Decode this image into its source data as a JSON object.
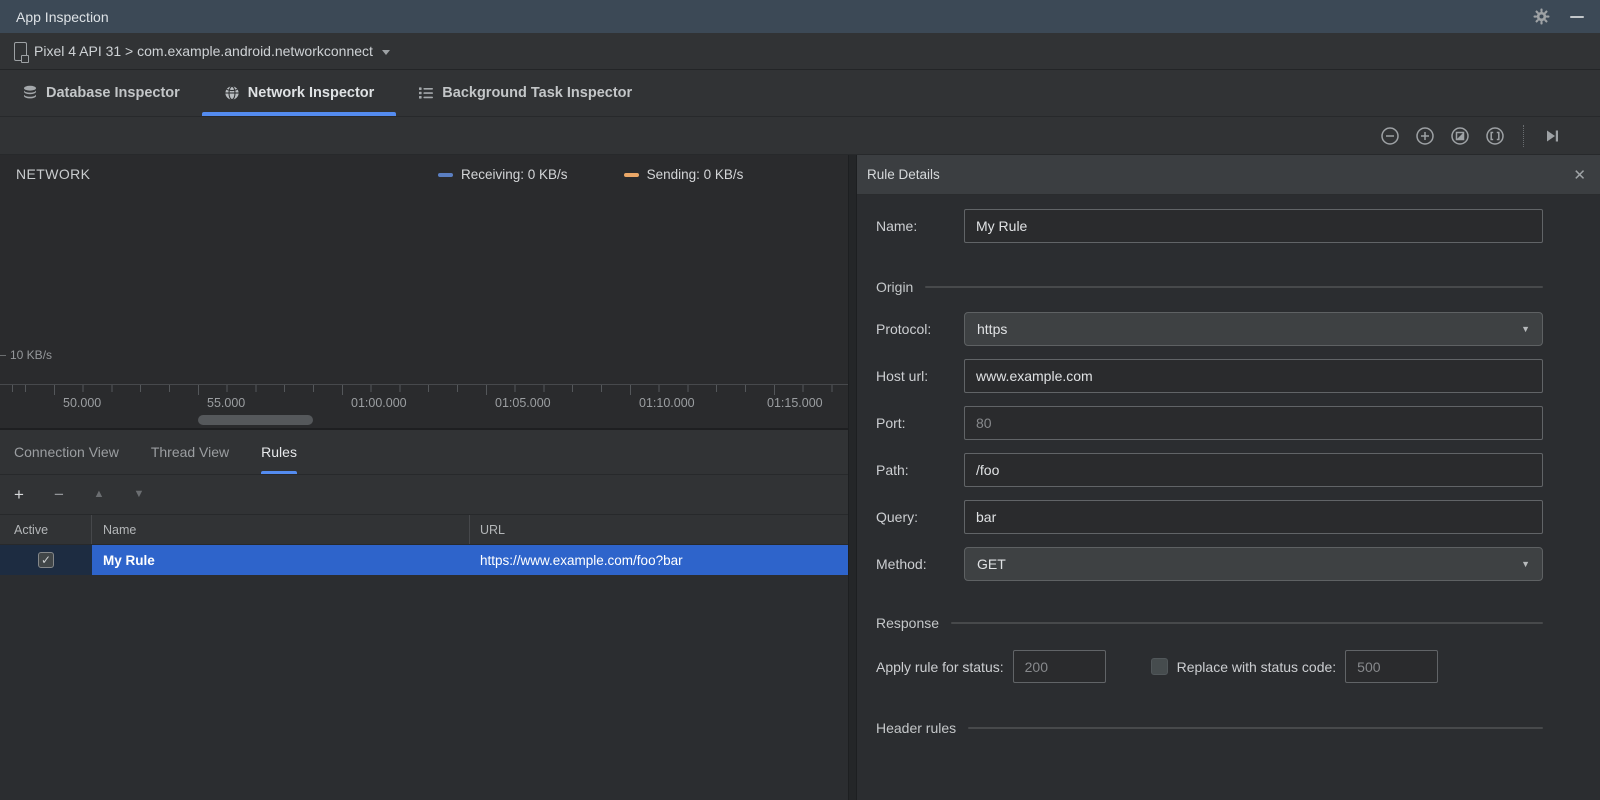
{
  "titlebar": {
    "title": "App Inspection"
  },
  "device_bar": {
    "selection": "Pixel 4 API 31 > com.example.android.networkconnect"
  },
  "tabs": {
    "database": "Database Inspector",
    "network": "Network Inspector",
    "background": "Background Task Inspector"
  },
  "zoom_toolbar": {
    "icons": [
      "zoom-out",
      "zoom-in",
      "reset-zoom",
      "zoom-to-selection",
      "go-live"
    ]
  },
  "chart": {
    "title": "NETWORK",
    "y_axis_label": "10 KB/s",
    "legend": {
      "receiving": "Receiving: 0 KB/s",
      "sending": "Sending: 0 KB/s"
    },
    "colors": {
      "receiving": "#5b7fc2",
      "sending": "#eaa767",
      "selection_blue": "#2e64cb",
      "tab_underline": "#548cf0"
    },
    "timeline": [
      "50.000",
      "55.000",
      "01:00.000",
      "01:05.000",
      "01:10.000",
      "01:15.000"
    ]
  },
  "chart_data": {
    "type": "line",
    "title": "NETWORK",
    "x": [
      "50.000",
      "55.000",
      "01:00.000",
      "01:05.000",
      "01:10.000",
      "01:15.000"
    ],
    "series": [
      {
        "name": "Receiving",
        "values": [
          0,
          0,
          0,
          0,
          0,
          0
        ],
        "unit": "KB/s",
        "color": "#5b7fc2"
      },
      {
        "name": "Sending",
        "values": [
          0,
          0,
          0,
          0,
          0,
          0
        ],
        "unit": "KB/s",
        "color": "#eaa767"
      }
    ],
    "ylabel": "KB/s",
    "ylim": [
      0,
      10
    ],
    "grid": false,
    "legend_position": "top-right"
  },
  "view_tabs": {
    "connection": "Connection View",
    "thread": "Thread View",
    "rules": "Rules"
  },
  "rules_table": {
    "columns": [
      "Active",
      "Name",
      "URL"
    ],
    "rows": [
      {
        "active": true,
        "name": "My Rule",
        "url": "https://www.example.com/foo?bar"
      }
    ]
  },
  "rule_details": {
    "title": "Rule Details",
    "name_label": "Name:",
    "name_value": "My Rule",
    "origin_section": "Origin",
    "protocol_label": "Protocol:",
    "protocol_value": "https",
    "host_label": "Host url:",
    "host_value": "www.example.com",
    "port_label": "Port:",
    "port_placeholder": "80",
    "path_label": "Path:",
    "path_value": "/foo",
    "query_label": "Query:",
    "query_value": "bar",
    "method_label": "Method:",
    "method_value": "GET",
    "response_section": "Response",
    "status_label": "Apply rule for status:",
    "status_placeholder": "200",
    "replace_checkbox_checked": false,
    "replace_label": "Replace with status code:",
    "replace_placeholder": "500",
    "header_section": "Header rules"
  },
  "glyphs": {
    "plus": "+",
    "minus": "−",
    "up": "▲",
    "down": "▼",
    "check": "✓",
    "close": "✕",
    "dropdown": "▼"
  }
}
